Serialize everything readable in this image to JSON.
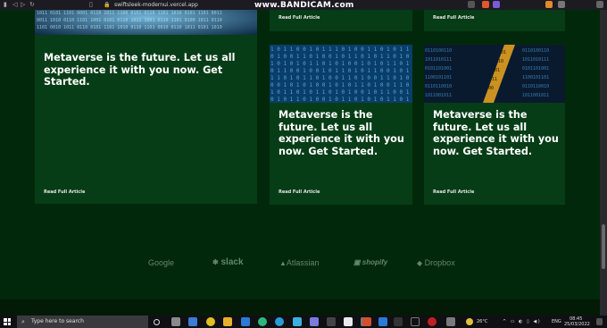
{
  "browser": {
    "url": "swiftsleek-modernui.vercel.app",
    "watermark": "www.BANDICAM.com"
  },
  "cards": [
    {
      "title": "Metaverse is the future. Let us all experience it with you now. Get Started.",
      "read_more": "Read Full Article"
    },
    {
      "title": "Metaverse is the future. Let us all experience it with you now. Get Started.",
      "read_more": "Read Full Article"
    },
    {
      "title": "Metaverse is the future. Let us all experience it with you now. Get Started.",
      "read_more": "Read Full Article"
    }
  ],
  "top_cards": [
    {
      "read_more": "Read Full Article"
    },
    {
      "read_more": "Read Full Article"
    }
  ],
  "brands": [
    "Google",
    "slack",
    "Atlassian",
    "shopify",
    "Dropbox"
  ],
  "taskbar": {
    "search_placeholder": "Type here to search",
    "temperature": "26°C",
    "language": "ENG",
    "time": "08:45",
    "date": "25/03/2022"
  },
  "colors": {
    "page_bg": "#02280b",
    "card_bg": "#063d16",
    "brand_logo": "#5f8a68"
  }
}
